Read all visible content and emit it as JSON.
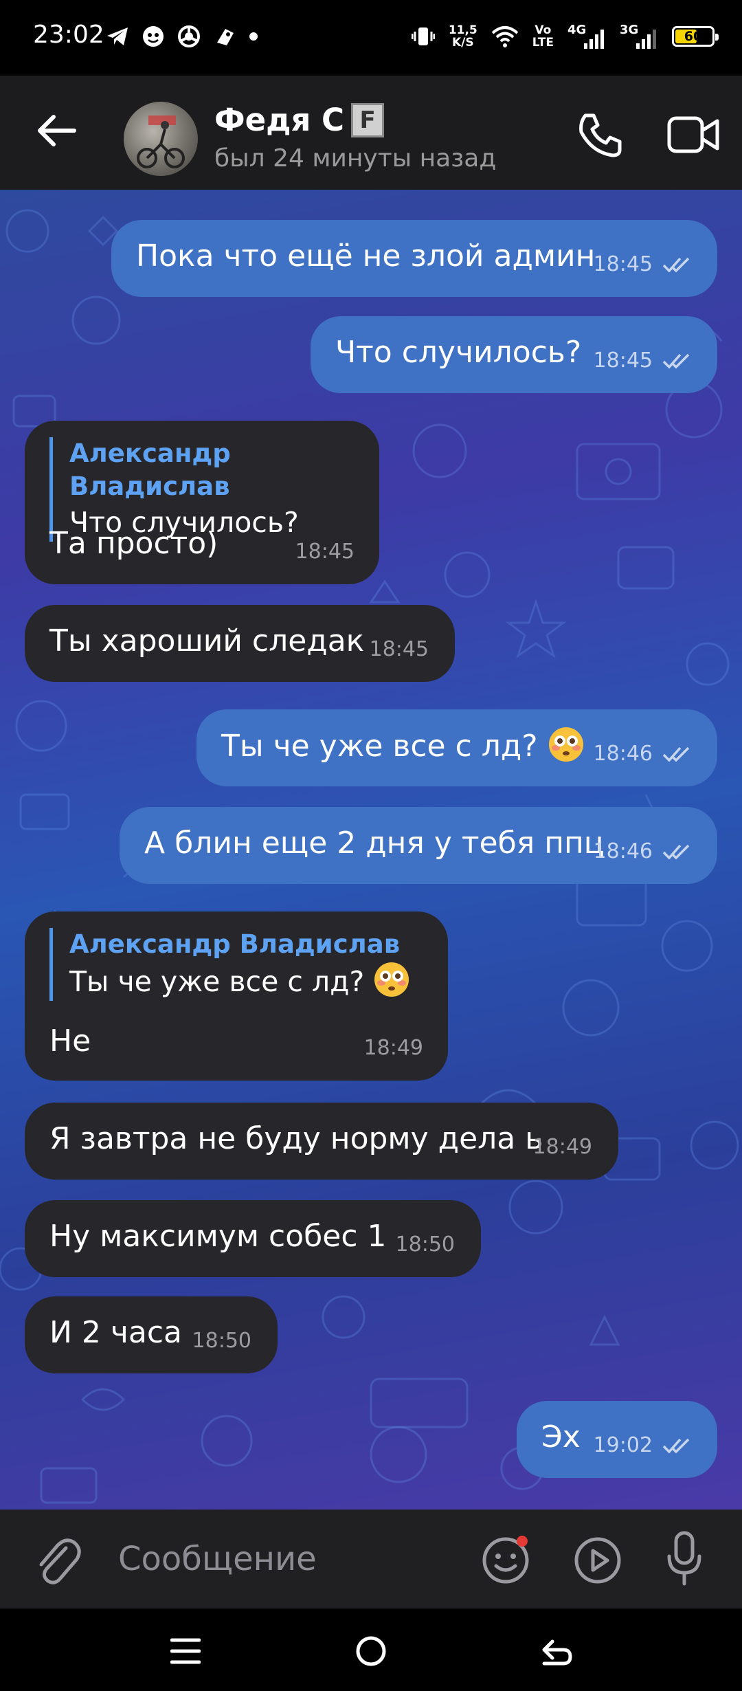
{
  "status_bar": {
    "time": "23:02",
    "net_speed_top": "11,5",
    "net_speed_bottom": "K/S",
    "volte_top": "Vo",
    "volte_bottom": "LTE",
    "sim1_type": "4G",
    "sim2_type": "3G",
    "battery_level": "60",
    "battery_fraction": 0.6,
    "icons": [
      "telegram-icon",
      "vk-icon",
      "chrome-icon",
      "app-icon",
      "dot-icon",
      "vibrate-icon",
      "wifi-icon",
      "signal-icon",
      "battery-icon"
    ]
  },
  "header": {
    "contact_name": "Федя С",
    "badge": "F",
    "last_seen": "был 24 минуты назад"
  },
  "messages": [
    {
      "dir": "out",
      "text": "Пока что ещё не злой админ",
      "time": "18:45",
      "status": "read"
    },
    {
      "dir": "out",
      "text": "Что случилось?",
      "time": "18:45",
      "status": "read"
    },
    {
      "dir": "in",
      "reply_name": "Александр Владислав",
      "reply_text": "Что случилось?",
      "text": "Та просто)",
      "time": "18:45"
    },
    {
      "dir": "in",
      "text": "Ты хароший следак",
      "time": "18:45"
    },
    {
      "dir": "out",
      "text": "Ты че уже все с лд?",
      "emoji": "flushed-face-emoji",
      "time": "18:46",
      "status": "read"
    },
    {
      "dir": "out",
      "text": "А блин еще 2 дня у тебя ппц",
      "time": "18:46",
      "status": "read"
    },
    {
      "dir": "in",
      "reply_name": "Александр Владислав",
      "reply_text": "Ты че уже все с лд?",
      "reply_emoji": "flushed-face-emoji",
      "text": "Не",
      "time": "18:49"
    },
    {
      "dir": "in",
      "text": "Я завтра не буду норму дела ь",
      "time": "18:49"
    },
    {
      "dir": "in",
      "text": "Ну максимум собес 1",
      "time": "18:50"
    },
    {
      "dir": "in",
      "text": "И 2 часа",
      "time": "18:50"
    },
    {
      "dir": "out",
      "text": "Эх",
      "time": "19:02",
      "status": "read"
    }
  ],
  "input": {
    "placeholder": "Сообщение"
  },
  "colors": {
    "outgoing_bubble": "#3f72c4",
    "incoming_bubble": "#27272b",
    "reply_accent": "#5ea2f4",
    "battery": "#f6d400"
  }
}
